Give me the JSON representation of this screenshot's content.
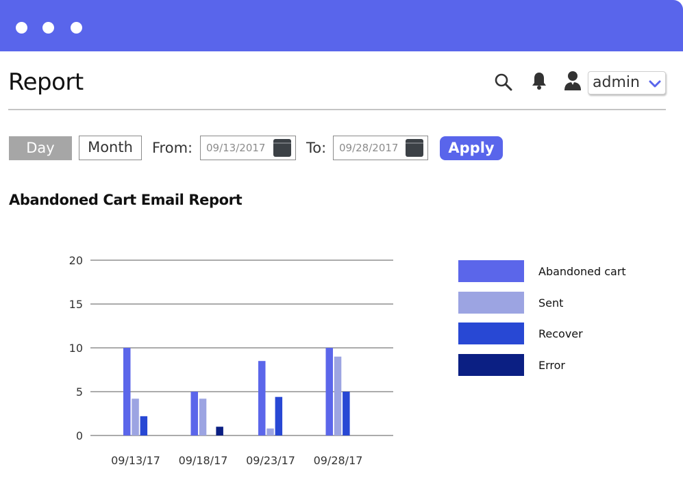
{
  "window": {
    "title_color": "#5965eb"
  },
  "header": {
    "title": "Report",
    "user": {
      "name": "admin"
    },
    "icons": [
      "search-icon",
      "bell-icon",
      "user-icon",
      "chevron-down-icon"
    ]
  },
  "filters": {
    "day_label": "Day",
    "month_label": "Month",
    "from_label": "From:",
    "from_date": "09/13/2017",
    "to_label": "To:",
    "to_date": "09/28/2017",
    "apply_label": "Apply",
    "selected_period": "Day"
  },
  "report": {
    "title": "Abandoned Cart Email Report"
  },
  "chart_data": {
    "type": "bar",
    "categories": [
      "09/13/17",
      "09/18/17",
      "09/23/17",
      "09/28/17"
    ],
    "series": [
      {
        "name": "Abandoned cart",
        "values": [
          10,
          5,
          8.5,
          10
        ],
        "color": "#5b66ea"
      },
      {
        "name": "Sent",
        "values": [
          4.2,
          4.2,
          0.8,
          9
        ],
        "color": "#9ca4e2"
      },
      {
        "name": "Recover",
        "values": [
          2.2,
          0,
          4.4,
          5
        ],
        "color": "#2848d4"
      },
      {
        "name": "Error",
        "values": [
          0,
          1,
          0,
          0
        ],
        "color": "#0b1f83"
      }
    ],
    "yticks": [
      0,
      5,
      10,
      15,
      20
    ],
    "ylim": [
      0,
      20
    ],
    "grid": true,
    "legend_position": "right"
  }
}
